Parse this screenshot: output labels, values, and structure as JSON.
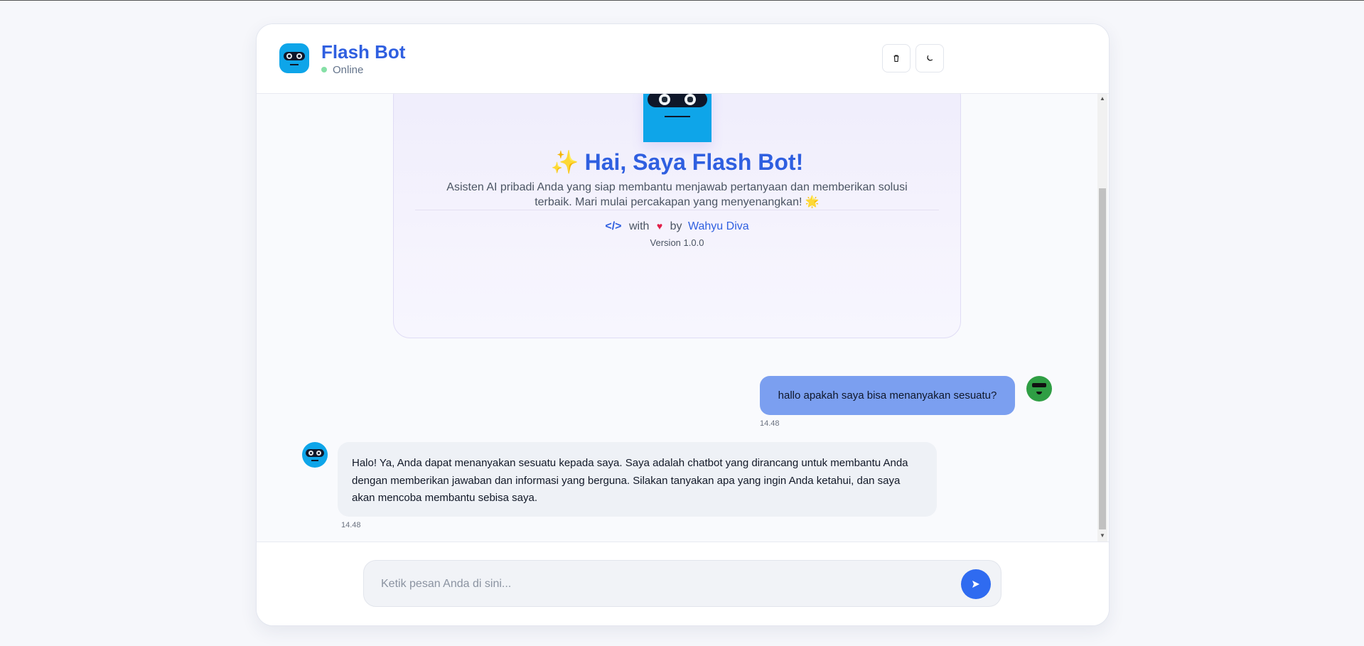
{
  "header": {
    "title": "Flash Bot",
    "status": "Online",
    "clear_icon": "trash-icon",
    "theme_icon": "moon-icon"
  },
  "welcome": {
    "emoji": "✨",
    "title": "Hai, Saya Flash Bot!",
    "description": "Asisten AI pribadi Anda yang siap membantu menjawab pertanyaan dan memberikan solusi terbaik. Mari mulai percakapan yang menyenangkan!",
    "description_emoji": "🌟",
    "credit_code": "</>",
    "credit_with": "with",
    "credit_heart": "♥",
    "credit_by": "by",
    "author": "Wahyu Diva",
    "version": "Version 1.0.0"
  },
  "messages": [
    {
      "role": "user",
      "text": "hallo apakah saya bisa menanyakan sesuatu?",
      "time": "14.48"
    },
    {
      "role": "bot",
      "text": "Halo! Ya, Anda dapat menanyakan sesuatu kepada saya. Saya adalah chatbot yang dirancang untuk membantu Anda dengan memberikan jawaban dan informasi yang berguna. Silakan tanyakan apa yang ingin Anda ketahui, dan saya akan mencoba membantu sebisa saya.",
      "time": "14.48"
    }
  ],
  "composer": {
    "placeholder": "Ketik pesan Anda di sini...",
    "value": "",
    "send_icon": "send-icon"
  },
  "colors": {
    "accent": "#2f5fe0",
    "user_bubble": "#7b9ff0",
    "bot_bubble": "#eef1f6",
    "online": "#86e0a7"
  }
}
